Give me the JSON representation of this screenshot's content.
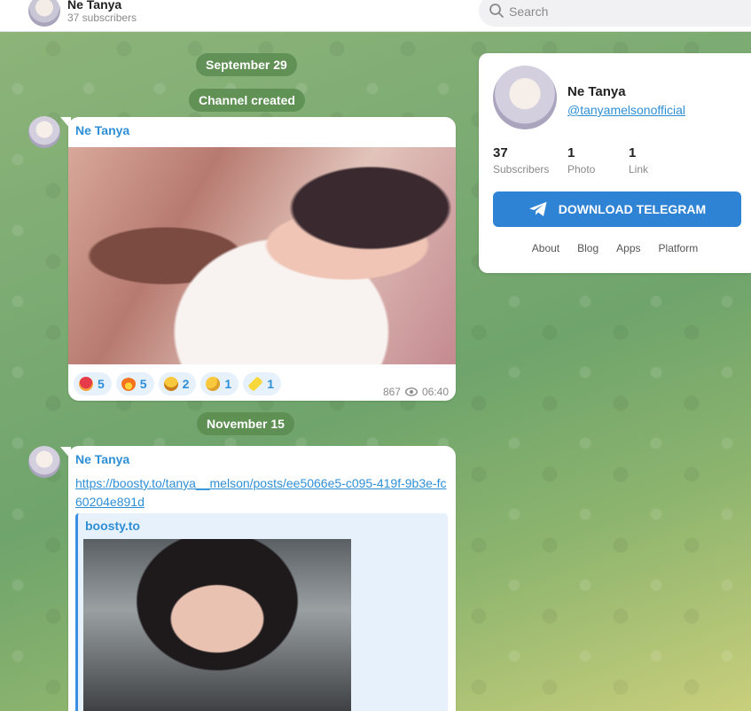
{
  "header": {
    "channel_title": "Ne Tanya",
    "subscribers_text": "37 subscribers",
    "search_placeholder": "Search"
  },
  "feed": {
    "date_1": "September 29",
    "service_1": "Channel created",
    "post_1": {
      "author": "Ne Tanya",
      "reactions": [
        {
          "emoji_icon": "heart-on-fire-icon",
          "count": "5"
        },
        {
          "emoji_icon": "fire-icon",
          "count": "5"
        },
        {
          "emoji_icon": "grinning-face-icon",
          "count": "2"
        },
        {
          "emoji_icon": "thinking-face-icon",
          "count": "1"
        },
        {
          "emoji_icon": "banana-icon",
          "count": "1"
        }
      ],
      "views": "867",
      "time": "06:40"
    },
    "date_2": "November 15",
    "post_2": {
      "author": "Ne Tanya",
      "link": "https://boosty.to/tanya__melson/posts/ee5066e5-c095-419f-9b3e-fc60204e891d",
      "preview_site": "boosty.to"
    }
  },
  "sidebar_card": {
    "name": "Ne Tanya",
    "username": "@tanyamelsonofficial",
    "stats": [
      {
        "value": "37",
        "label": "Subscribers"
      },
      {
        "value": "1",
        "label": "Photo"
      },
      {
        "value": "1",
        "label": "Link"
      }
    ],
    "download_label": "DOWNLOAD TELEGRAM",
    "links": [
      "About",
      "Blog",
      "Apps",
      "Platform"
    ]
  },
  "colors": {
    "accent": "#2f83d4",
    "link": "#2f8fd6",
    "pill_bg": "#5a8c50"
  }
}
